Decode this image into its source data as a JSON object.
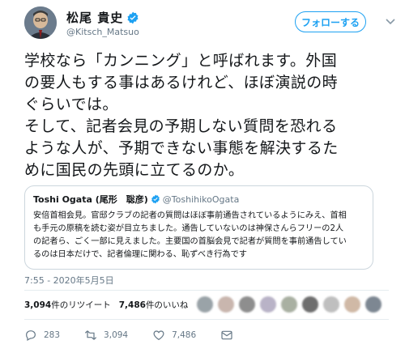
{
  "user": {
    "display_name": "松尾 貴史",
    "handle": "@Kitsch_Matsuo",
    "follow_label": "フォローする"
  },
  "tweet": {
    "lines": [
      "学校なら「カンニング」と呼ばれます。外国",
      "の要人もする事はあるけれど、ほぼ演説の時",
      "ぐらいでは。",
      "そして、記者会見の予期しない質問を恐れる",
      "ような人が、予期できない事態を解決するた",
      "めに国民の先頭に立てるのか。"
    ],
    "timestamp": "7:55 - 2020年5月5日"
  },
  "quoted": {
    "name": "Toshi Ogata (尾形　聡彦)",
    "handle": "@ToshihikoOgata",
    "lines": [
      "安倍首相会見。官邸クラブの記者の質問はほぼ事前通告されているようにみえ、首相",
      "も手元の原稿を読む姿が目立ちました。通告していないのは神保さんらフリーの2人",
      "の記者ら、ごく一部に見えました。主要国の首脳会見で記者が質問を事前通告してい",
      "るのは日本だけで、記者倫理に関わる、恥ずべき行為です"
    ]
  },
  "stats": {
    "retweets_count": "3,094",
    "retweets_label": "件のリツイート",
    "likes_count": "7,486",
    "likes_label": "件のいいね"
  },
  "actions": {
    "reply_count": "283",
    "retweet_count": "3,094",
    "like_count": "7,486"
  },
  "colors": {
    "accent": "#1da1f2",
    "verified": "#1da1f2",
    "muted": "#657786"
  },
  "liker_avatar_colors": [
    "#9aa3a8",
    "#c9b6ae",
    "#8e8e8e",
    "#b9b3c7",
    "#a9b0a2",
    "#6f6f6f",
    "#bfbfbf",
    "#d0b9a6",
    "#7d8792"
  ]
}
